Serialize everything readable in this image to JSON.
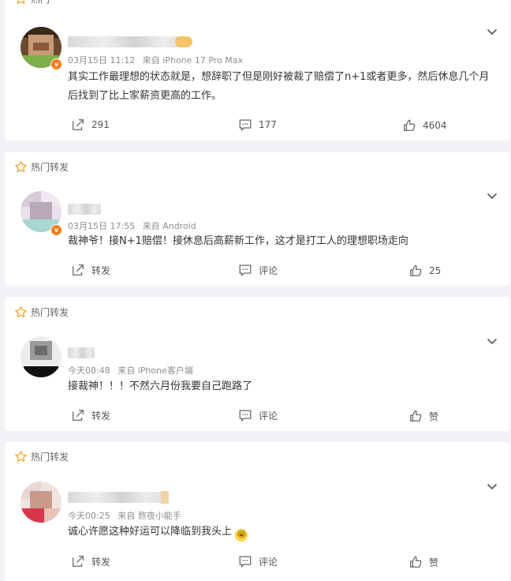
{
  "hot_label": "热门",
  "repost_hot_label": "热门转发",
  "comments": [
    {
      "time": "03月15日 11:12",
      "source": "来自 iPhone 17 Pro Max",
      "text": "其实工作最理想的状态就是，想辞职了但是刚好被裁了赔偿了n+1或者更多，然后休息几个月后找到了比上家薪资更高的工作。",
      "repost": "291",
      "comment": "177",
      "like": "4604"
    },
    {
      "time": "03月15日 17:55",
      "source": "来自 Android",
      "text": "裁神爷！接N+1赔偿！接休息后高薪新工作，这才是打工人的理想职场走向",
      "repost": "转发",
      "comment": "评论",
      "like": "25"
    },
    {
      "time": "今天08:48",
      "source": "来自 iPhone客户端",
      "text": "接裁神！！！不然六月份我要自己跑路了",
      "repost": "转发",
      "comment": "评论",
      "like": "赞"
    },
    {
      "time": "今天00:25",
      "source": "来自 熬夜小能手",
      "text": "诚心许愿这种好运可以降临到我头上",
      "emoji": "😭",
      "repost": "转发",
      "comment": "评论",
      "like": "赞"
    }
  ],
  "colors": {
    "star": "#f5a623",
    "vip": "#f67e1b",
    "text": "#333333",
    "meta": "#8d8d8d"
  }
}
